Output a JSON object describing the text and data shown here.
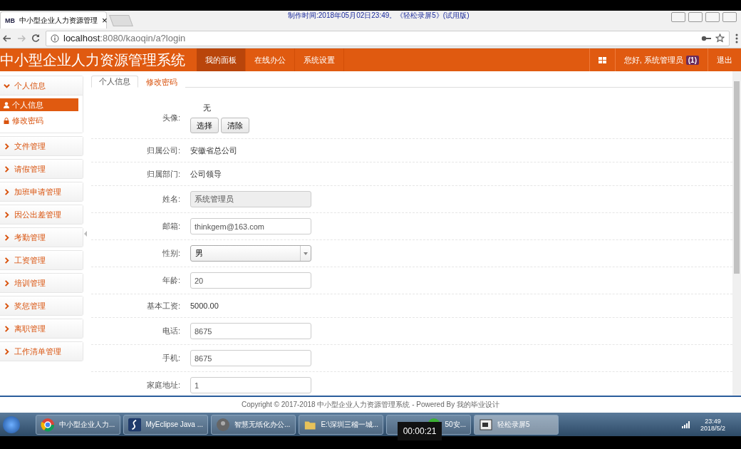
{
  "recorder_caption": "制作时间:2018年05月02日23:49。《轻松录屏5》(试用版)",
  "browser": {
    "tab": {
      "logo": "MB",
      "title": "中小型企业人力资源管理",
      "close": "×"
    },
    "url_host": "localhost",
    "url_rest": ":8080/kaoqin/a?login"
  },
  "app": {
    "title": "中小型企业人力资源管理系统",
    "nav": [
      {
        "label": "我的面板",
        "selected": true
      },
      {
        "label": "在线办公",
        "selected": false
      },
      {
        "label": "系统设置",
        "selected": false
      }
    ],
    "greeting": "您好, 系统管理员",
    "badge": "(1)",
    "logout": "退出"
  },
  "sidebar": [
    {
      "label": "个人信息",
      "expanded": true,
      "children": [
        {
          "label": "个人信息",
          "selected": true
        },
        {
          "label": "修改密码",
          "selected": false
        }
      ]
    },
    {
      "label": "文件管理",
      "expanded": false
    },
    {
      "label": "请假管理",
      "expanded": false
    },
    {
      "label": "加班申请管理",
      "expanded": false
    },
    {
      "label": "因公出差管理",
      "expanded": false
    },
    {
      "label": "考勤管理",
      "expanded": false
    },
    {
      "label": "工资管理",
      "expanded": false
    },
    {
      "label": "培训管理",
      "expanded": false
    },
    {
      "label": "奖惩管理",
      "expanded": false
    },
    {
      "label": "离职管理",
      "expanded": false
    },
    {
      "label": "工作清单管理",
      "expanded": false
    }
  ],
  "tabs": [
    {
      "label": "个人信息",
      "selected": true
    },
    {
      "label": "修改密码",
      "selected": false
    }
  ],
  "form": [
    {
      "kind": "avatar",
      "label": "头像:",
      "value": "无",
      "buttons": [
        "选择",
        "清除"
      ]
    },
    {
      "kind": "text",
      "label": "归属公司:",
      "value": "安徽省总公司"
    },
    {
      "kind": "text",
      "label": "归属部门:",
      "value": "公司领导"
    },
    {
      "kind": "input",
      "label": "姓名:",
      "value": "系统管理员",
      "disabled": true
    },
    {
      "kind": "input",
      "label": "邮箱:",
      "value": "thinkgem@163.com",
      "disabled": false
    },
    {
      "kind": "select",
      "label": "性别:",
      "value": "男"
    },
    {
      "kind": "input",
      "label": "年龄:",
      "value": "20",
      "disabled": false
    },
    {
      "kind": "text",
      "label": "基本工资:",
      "value": "5000.00"
    },
    {
      "kind": "input",
      "label": "电话:",
      "value": "8675",
      "disabled": false
    },
    {
      "kind": "input",
      "label": "手机:",
      "value": "8675",
      "disabled": false
    },
    {
      "kind": "input",
      "label": "家庭地址:",
      "value": "1",
      "disabled": false
    }
  ],
  "footer": "Copyright © 2017-2018 中小型企业人力资源管理系统 - Powered By 我的毕业设计",
  "taskbar": {
    "items": [
      {
        "label": "中小型企业人力..."
      },
      {
        "label": "MyEclipse Java ..."
      },
      {
        "label": "智慧无纸化办公..."
      },
      {
        "label": "E:\\深圳三稽一城..."
      },
      {
        "label": "50安..."
      },
      {
        "label": "轻松录屏5",
        "selected": true
      }
    ],
    "time": "23:49",
    "date": "2018/5/2"
  },
  "timer": "00:00:21"
}
